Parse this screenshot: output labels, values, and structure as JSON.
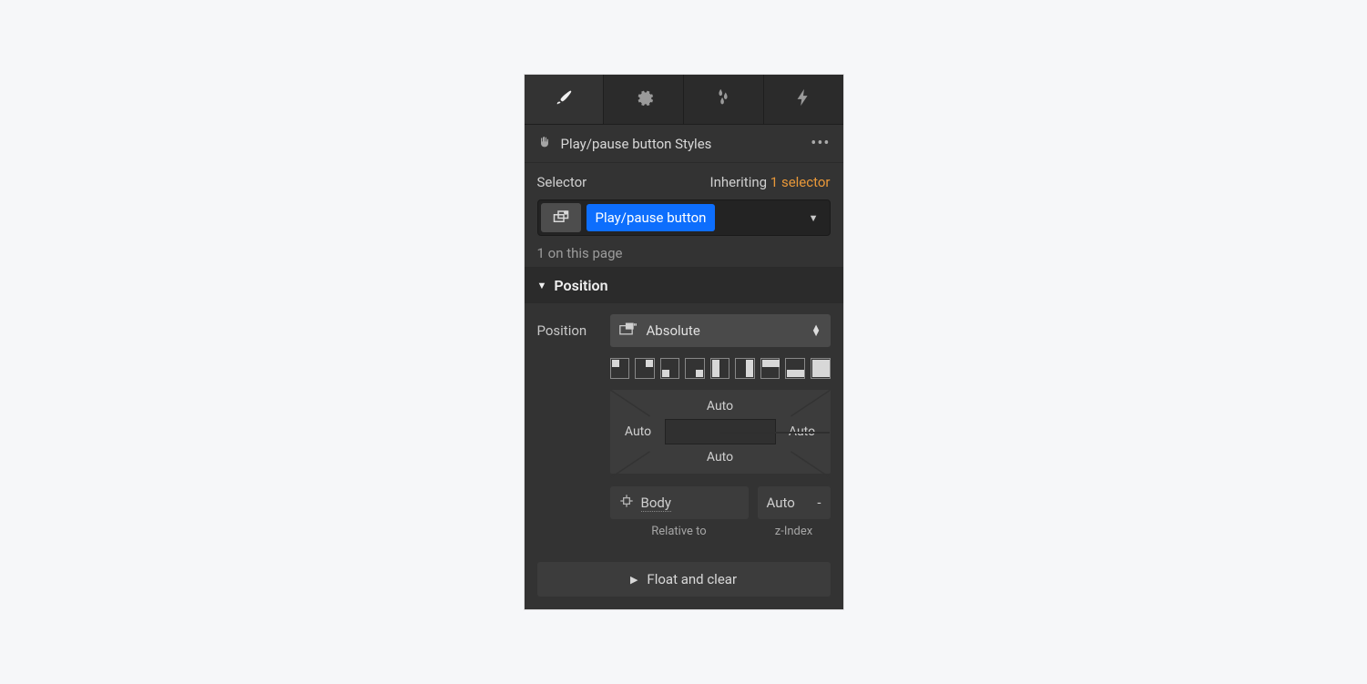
{
  "header": {
    "title": "Play/pause button Styles"
  },
  "selector": {
    "label": "Selector",
    "inheriting_label": "Inheriting",
    "inheriting_link": "1 selector",
    "chip": "Play/pause button",
    "footer": "1 on this page"
  },
  "section": {
    "position_title": "Position",
    "position_label": "Position",
    "position_value": "Absolute",
    "offset_top": "Auto",
    "offset_right": "Auto",
    "offset_bottom": "Auto",
    "offset_left": "Auto",
    "relative_to_value": "Body",
    "relative_to_label": "Relative to",
    "zindex_value": "Auto",
    "zindex_dash": "-",
    "zindex_label": "z-Index",
    "float_clear": "Float and clear"
  }
}
